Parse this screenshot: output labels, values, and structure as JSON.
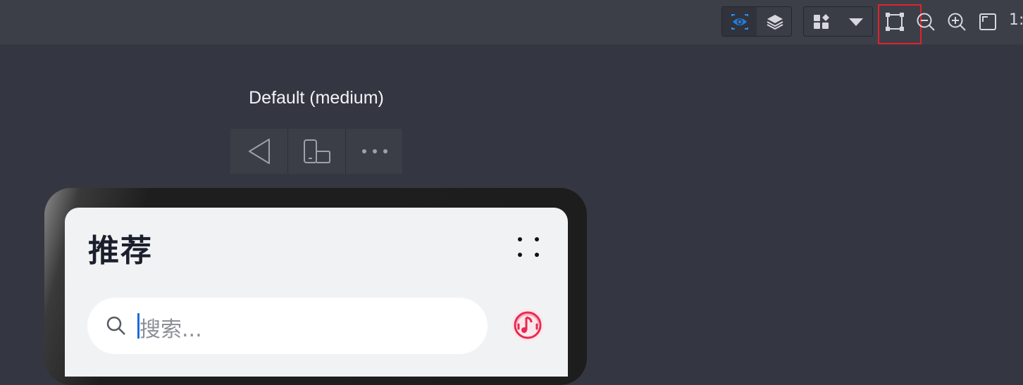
{
  "toolbar": {
    "scale_label": "1:"
  },
  "device": {
    "title": "Default (medium)"
  },
  "app": {
    "title": "推荐",
    "search": {
      "placeholder": "搜索..."
    }
  },
  "icons": {
    "preview": "eye-icon",
    "layers": "layers-icon",
    "components": "components-icon",
    "dropdown": "caret-down-icon",
    "selection": "bounding-box-icon",
    "zoom_out": "zoom-out-icon",
    "zoom_in": "zoom-in-icon",
    "fit": "fit-screen-icon",
    "back": "back-triangle-icon",
    "rotate": "rotate-device-icon",
    "more": "more-dots-icon",
    "grid": "four-dots-icon",
    "search": "search-icon",
    "music": "music-icon"
  },
  "colors": {
    "accent": "#1a7fe8",
    "highlight": "#e0232b",
    "music": "#e8294f"
  }
}
